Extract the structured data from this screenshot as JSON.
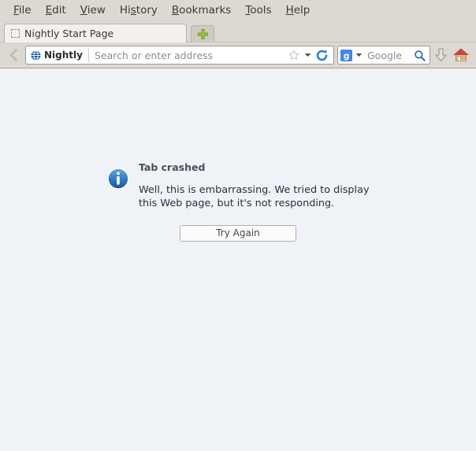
{
  "menubar": {
    "items": [
      {
        "label": "File",
        "accel_index": 0
      },
      {
        "label": "Edit",
        "accel_index": 0
      },
      {
        "label": "View",
        "accel_index": 0
      },
      {
        "label": "History",
        "accel_index": 2
      },
      {
        "label": "Bookmarks",
        "accel_index": 0
      },
      {
        "label": "Tools",
        "accel_index": 0
      },
      {
        "label": "Help",
        "accel_index": 0
      }
    ]
  },
  "tabstrip": {
    "tabs": [
      {
        "title": "Nightly Start Page",
        "favicon": "blank-favicon-placeholder",
        "active": true
      }
    ],
    "new_tab_label": "+",
    "new_tab_icon": "plus-icon"
  },
  "navbar": {
    "back_icon": "chevron-left-icon",
    "identity_label": "Nightly",
    "identity_icon": "globe-icon",
    "address_placeholder": "Search or enter address",
    "address_value": "",
    "star_icon": "star-outline-icon",
    "dropdown_icon": "chevron-down-icon",
    "reload_icon": "reload-icon",
    "search_engine": "Google",
    "search_engine_icon": "google-g-icon",
    "search_placeholder": "Google",
    "search_value": "",
    "search_go_icon": "magnifier-icon",
    "downloads_icon": "download-arrow-icon",
    "home_icon": "home-icon"
  },
  "content": {
    "notification_icon": "info-icon",
    "title": "Tab crashed",
    "message": "Well, this is embarrassing. We tried to display this Web page, but it's not responding.",
    "try_again_label": "Try Again"
  },
  "colors": {
    "chrome_bg": "#dcd8d2",
    "content_bg": "#eff2f7",
    "tab_active_bg": "#f3f1ee",
    "info_blue": "#2a6fbb",
    "accent_green": "#8cc63f",
    "home_red": "#c0392b",
    "google_blue": "#4285f4",
    "text_dark": "#2b2f36",
    "text_muted": "#8d8d8d"
  }
}
